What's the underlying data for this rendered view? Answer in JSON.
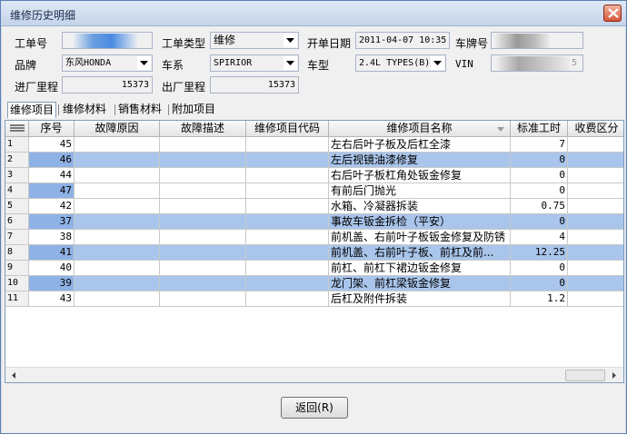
{
  "window": {
    "title": "维修历史明细"
  },
  "form": {
    "order_no_label": "工单号",
    "order_type_label": "工单类型",
    "order_type_value": "维修",
    "open_date_label": "开单日期",
    "open_date_value": "2011-04-07 10:35",
    "plate_label": "车牌号",
    "brand_label": "品牌",
    "brand_value": "东风HONDA",
    "series_label": "车系",
    "series_value": "SPIRIOR",
    "model_label": "车型",
    "model_value": "2.4L TYPES(B)",
    "vin_label": "VIN",
    "vin_tail": "5",
    "in_mileage_label": "进厂里程",
    "in_mileage_value": "15373",
    "out_mileage_label": "出厂里程",
    "out_mileage_value": "15373"
  },
  "tabs": [
    {
      "label": "维修项目"
    },
    {
      "label": "维修材料"
    },
    {
      "label": "销售材料"
    },
    {
      "label": "附加项目"
    }
  ],
  "grid": {
    "headers": [
      "序号",
      "故障原因",
      "故障描述",
      "维修项目代码",
      "维修项目名称",
      "标准工时",
      "收费区分"
    ],
    "rows": [
      {
        "n": "1",
        "seq": "45",
        "name": "左右后叶子板及后杠全漆",
        "hours": "7",
        "highlight": false
      },
      {
        "n": "2",
        "seq": "46",
        "name": "左后视镜油漆修复",
        "hours": "0",
        "highlight": true
      },
      {
        "n": "3",
        "seq": "44",
        "name": "右后叶子板杠角处钣金修复",
        "hours": "0",
        "highlight": false
      },
      {
        "n": "4",
        "seq": "47",
        "name": "有前后门抛光",
        "hours": "0",
        "highlight": false
      },
      {
        "n": "5",
        "seq": "42",
        "name": "水箱、冷凝器拆装",
        "hours": "0.75",
        "highlight": false
      },
      {
        "n": "6",
        "seq": "37",
        "name": "事故车钣金拆检（平安）",
        "hours": "0",
        "highlight": true
      },
      {
        "n": "7",
        "seq": "38",
        "name": "前机盖、右前叶子板钣金修复及防锈",
        "hours": "4",
        "highlight": false
      },
      {
        "n": "8",
        "seq": "41",
        "name": "前机盖、右前叶子板、前杠及前...",
        "hours": "12.25",
        "highlight": true
      },
      {
        "n": "9",
        "seq": "40",
        "name": "前杠、前杠下裙边钣金修复",
        "hours": "0",
        "highlight": false
      },
      {
        "n": "10",
        "seq": "39",
        "name": "龙门架、前杠梁钣金修复",
        "hours": "0",
        "highlight": true
      },
      {
        "n": "11",
        "seq": "43",
        "name": "后杠及附件拆装",
        "hours": "1.2",
        "highlight": false
      }
    ]
  },
  "footer": {
    "back_label": "返回(R)"
  },
  "colors": {
    "highlight_row": "#a9c5eb",
    "selection_cell": "#8fb2e6"
  }
}
